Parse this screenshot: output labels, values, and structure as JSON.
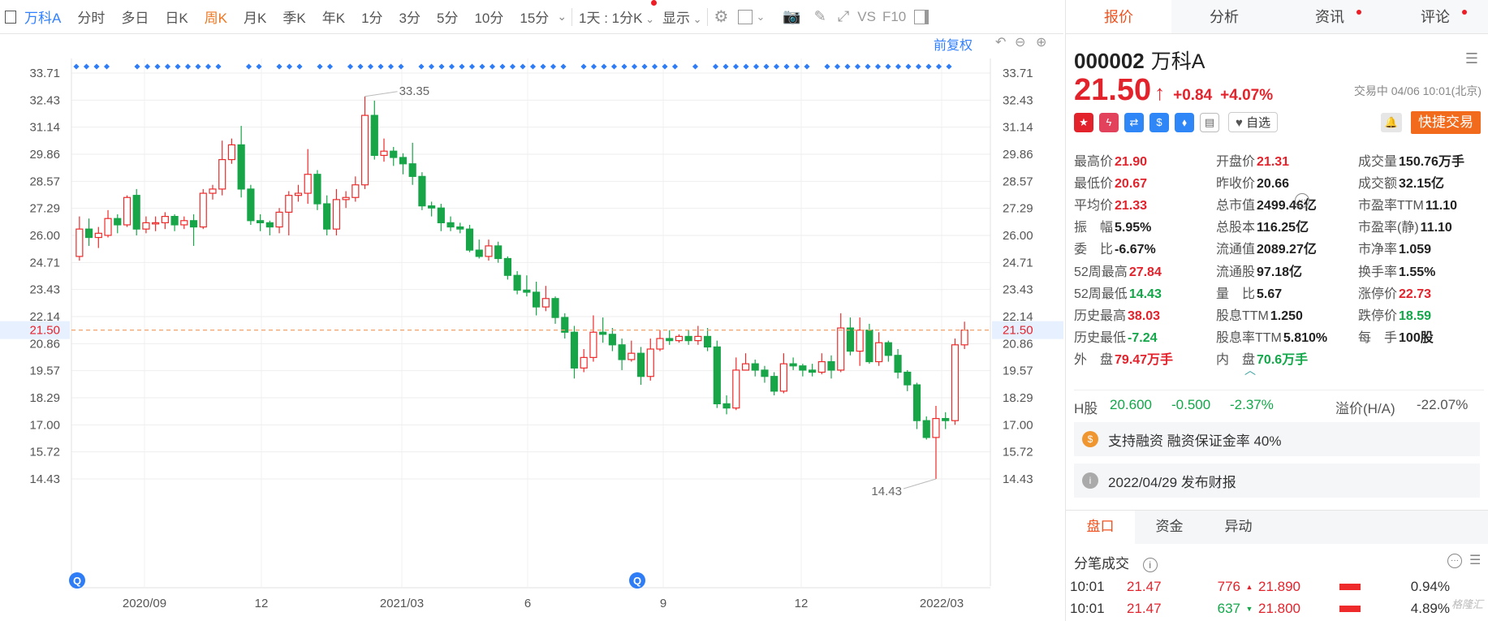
{
  "toolbar": {
    "stock_name": "万科A",
    "periods": [
      "分时",
      "多日",
      "日K",
      "周K",
      "月K",
      "季K",
      "年K",
      "1分",
      "3分",
      "5分",
      "10分",
      "15分"
    ],
    "active_period": "周K",
    "combo": "1天 : 1分K",
    "display": "显示",
    "vs": "VS",
    "f10": "F10",
    "restore": "前复权"
  },
  "chart": {
    "y_ticks": [
      "33.71",
      "32.43",
      "31.14",
      "29.86",
      "28.57",
      "27.29",
      "26.00",
      "24.71",
      "23.43",
      "22.14",
      "20.86",
      "19.57",
      "18.29",
      "17.00",
      "15.72",
      "14.43"
    ],
    "x_ticks": [
      "2020/09",
      "12",
      "2021/03",
      "6",
      "9",
      "12",
      "2022/03"
    ],
    "current_price_label": "21.50",
    "high_label": "33.35",
    "low_label": "14.43"
  },
  "chart_data": {
    "type": "candlestick",
    "ylim": [
      14.43,
      33.71
    ],
    "last": 21.5,
    "candles": [
      [
        25.0,
        26.3,
        24.8,
        26.9
      ],
      [
        26.3,
        25.9,
        25.5,
        26.8
      ],
      [
        25.9,
        26.1,
        25.4,
        26.4
      ],
      [
        26.0,
        26.8,
        25.9,
        27.2
      ],
      [
        26.8,
        26.5,
        26.1,
        27.0
      ],
      [
        26.5,
        27.8,
        26.4,
        27.9
      ],
      [
        27.9,
        26.3,
        26.0,
        28.2
      ],
      [
        26.3,
        26.6,
        26.1,
        26.9
      ],
      [
        26.6,
        26.6,
        26.2,
        26.9
      ],
      [
        26.6,
        26.9,
        26.3,
        27.1
      ],
      [
        26.9,
        26.5,
        26.2,
        27.0
      ],
      [
        26.5,
        26.7,
        26.3,
        26.9
      ],
      [
        26.7,
        26.4,
        25.5,
        27.0
      ],
      [
        26.4,
        28.0,
        26.3,
        28.2
      ],
      [
        28.0,
        28.2,
        27.7,
        28.4
      ],
      [
        28.2,
        29.6,
        27.9,
        30.5
      ],
      [
        29.6,
        30.3,
        29.4,
        30.6
      ],
      [
        30.3,
        28.2,
        27.8,
        31.2
      ],
      [
        28.2,
        26.7,
        26.5,
        28.4
      ],
      [
        26.7,
        26.6,
        26.2,
        27.0
      ],
      [
        26.6,
        26.4,
        26.0,
        26.7
      ],
      [
        26.4,
        27.1,
        26.1,
        27.3
      ],
      [
        27.1,
        27.9,
        26.0,
        28.1
      ],
      [
        27.9,
        28.0,
        27.6,
        28.4
      ],
      [
        28.0,
        28.9,
        27.5,
        30.1
      ],
      [
        28.9,
        27.5,
        27.2,
        29.1
      ],
      [
        27.5,
        26.3,
        26.0,
        27.9
      ],
      [
        26.3,
        27.7,
        26.0,
        28.2
      ],
      [
        27.7,
        27.8,
        27.3,
        28.1
      ],
      [
        27.8,
        28.4,
        27.6,
        28.8
      ],
      [
        28.4,
        31.7,
        28.2,
        32.6
      ],
      [
        31.7,
        29.8,
        29.6,
        32.4
      ],
      [
        29.8,
        30.0,
        29.5,
        30.6
      ],
      [
        30.0,
        29.7,
        29.3,
        30.2
      ],
      [
        29.7,
        29.4,
        28.9,
        29.9
      ],
      [
        29.4,
        28.8,
        28.4,
        30.4
      ],
      [
        28.8,
        27.4,
        27.2,
        29.0
      ],
      [
        27.4,
        27.3,
        26.9,
        27.6
      ],
      [
        27.3,
        26.6,
        26.2,
        27.5
      ],
      [
        26.6,
        26.4,
        26.2,
        26.9
      ],
      [
        26.4,
        26.3,
        26.1,
        26.6
      ],
      [
        26.3,
        25.3,
        25.2,
        26.5
      ],
      [
        25.3,
        25.0,
        24.9,
        25.8
      ],
      [
        25.0,
        25.5,
        24.8,
        25.8
      ],
      [
        25.5,
        24.9,
        24.7,
        25.7
      ],
      [
        24.9,
        24.1,
        23.9,
        25.0
      ],
      [
        24.1,
        23.4,
        23.2,
        24.3
      ],
      [
        23.4,
        23.3,
        23.1,
        24.1
      ],
      [
        23.3,
        22.6,
        22.2,
        23.8
      ],
      [
        22.6,
        23.0,
        22.4,
        23.6
      ],
      [
        23.0,
        22.1,
        21.8,
        23.1
      ],
      [
        22.1,
        21.4,
        21.1,
        22.3
      ],
      [
        21.4,
        19.7,
        19.2,
        21.7
      ],
      [
        19.7,
        20.2,
        19.5,
        20.6
      ],
      [
        20.2,
        21.4,
        20.0,
        22.2
      ],
      [
        21.4,
        21.3,
        20.9,
        22.1
      ],
      [
        21.3,
        20.8,
        20.5,
        21.6
      ],
      [
        20.8,
        20.1,
        19.6,
        21.1
      ],
      [
        20.1,
        20.4,
        20.0,
        21.0
      ],
      [
        20.4,
        19.3,
        18.9,
        20.7
      ],
      [
        19.3,
        20.6,
        19.1,
        21.1
      ],
      [
        20.6,
        21.1,
        20.5,
        21.5
      ],
      [
        21.1,
        21.0,
        20.8,
        21.5
      ],
      [
        21.0,
        21.2,
        20.9,
        21.3
      ],
      [
        21.2,
        21.0,
        20.8,
        21.5
      ],
      [
        21.0,
        21.2,
        20.8,
        21.7
      ],
      [
        21.2,
        20.7,
        20.5,
        21.6
      ],
      [
        20.7,
        18.0,
        17.8,
        21.0
      ],
      [
        18.0,
        17.8,
        17.5,
        18.4
      ],
      [
        17.8,
        19.6,
        17.7,
        20.2
      ],
      [
        19.6,
        19.9,
        19.6,
        20.4
      ],
      [
        19.9,
        19.6,
        19.3,
        20.1
      ],
      [
        19.6,
        19.3,
        19.0,
        19.8
      ],
      [
        19.3,
        18.6,
        18.4,
        19.5
      ],
      [
        18.6,
        19.9,
        18.5,
        20.4
      ],
      [
        19.9,
        19.8,
        19.6,
        20.2
      ],
      [
        19.8,
        19.6,
        19.3,
        19.9
      ],
      [
        19.6,
        19.5,
        19.3,
        19.9
      ],
      [
        19.5,
        20.0,
        19.4,
        20.4
      ],
      [
        20.0,
        19.6,
        19.2,
        20.3
      ],
      [
        19.6,
        21.6,
        19.5,
        22.3
      ],
      [
        21.6,
        20.5,
        20.3,
        22.1
      ],
      [
        20.5,
        21.5,
        19.8,
        22.1
      ],
      [
        21.5,
        20.0,
        19.9,
        21.8
      ],
      [
        20.0,
        20.9,
        19.8,
        21.4
      ],
      [
        20.9,
        20.3,
        20.0,
        21.0
      ],
      [
        20.3,
        19.5,
        19.2,
        20.6
      ],
      [
        19.5,
        18.9,
        18.6,
        19.6
      ],
      [
        18.9,
        17.2,
        16.8,
        19.0
      ],
      [
        17.2,
        16.4,
        16.3,
        17.4
      ],
      [
        16.4,
        17.3,
        14.43,
        17.9
      ],
      [
        17.3,
        17.2,
        16.8,
        17.6
      ],
      [
        17.2,
        20.8,
        17.0,
        21.1
      ],
      [
        20.8,
        21.5,
        20.6,
        21.9
      ]
    ]
  },
  "quote": {
    "code": "000002",
    "name": "万科A",
    "price": "21.50",
    "arrow": "↑",
    "change": "+0.84",
    "change_pct": "+4.07%",
    "status": "交易中 04/06 10:01(北京)",
    "watch": "自选",
    "quick_trade": "快捷交易"
  },
  "tabs": [
    "报价",
    "分析",
    "资讯",
    "评论"
  ],
  "stats": [
    [
      {
        "l": "最高价",
        "v": "21.90",
        "c": "red"
      },
      {
        "l": "开盘价",
        "v": "21.31",
        "c": "red"
      },
      {
        "l": "成交量",
        "v": "150.76万手",
        "c": ""
      }
    ],
    [
      {
        "l": "最低价",
        "v": "20.67",
        "c": "red"
      },
      {
        "l": "昨收价",
        "v": "20.66",
        "c": ""
      },
      {
        "l": "成交额",
        "v": "32.15亿",
        "c": ""
      }
    ],
    [
      {
        "l": "平均价",
        "v": "21.33",
        "c": "red"
      },
      {
        "l": "总市值",
        "v": "2499.46亿",
        "c": ""
      },
      {
        "l": "市盈率TTM",
        "v": "11.10",
        "c": ""
      }
    ],
    [
      {
        "l": "振　幅",
        "v": "5.95%",
        "c": ""
      },
      {
        "l": "总股本",
        "v": "116.25亿",
        "c": ""
      },
      {
        "l": "市盈率(静)",
        "v": "11.10",
        "c": ""
      }
    ],
    [
      {
        "l": "委　比",
        "v": "-6.67%",
        "c": ""
      },
      {
        "l": "流通值",
        "v": "2089.27亿",
        "c": ""
      },
      {
        "l": "市净率",
        "v": "1.059",
        "c": ""
      }
    ],
    [
      {
        "l": "52周最高",
        "v": "27.84",
        "c": "red"
      },
      {
        "l": "流通股",
        "v": "97.18亿",
        "c": ""
      },
      {
        "l": "换手率",
        "v": "1.55%",
        "c": ""
      }
    ],
    [
      {
        "l": "52周最低",
        "v": "14.43",
        "c": "green"
      },
      {
        "l": "量　比",
        "v": "5.67",
        "c": ""
      },
      {
        "l": "涨停价",
        "v": "22.73",
        "c": "red"
      }
    ],
    [
      {
        "l": "历史最高",
        "v": "38.03",
        "c": "red"
      },
      {
        "l": "股息TTM",
        "v": "1.250",
        "c": ""
      },
      {
        "l": "跌停价",
        "v": "18.59",
        "c": "green"
      }
    ],
    [
      {
        "l": "历史最低",
        "v": "-7.24",
        "c": "green"
      },
      {
        "l": "股息率TTM",
        "v": "5.810%",
        "c": ""
      },
      {
        "l": "每　手",
        "v": "100股",
        "c": ""
      }
    ],
    [
      {
        "l": "外　盘",
        "v": "79.47万手",
        "c": "red"
      },
      {
        "l": "内　盘",
        "v": "70.6万手",
        "c": "green"
      },
      {
        "l": "",
        "v": "",
        "c": ""
      }
    ]
  ],
  "hshare": {
    "label": "H股",
    "price": "20.600",
    "change": "-0.500",
    "pct": "-2.37%",
    "premium_label": "溢价(H/A)",
    "premium": "-22.07%"
  },
  "margin_text": "支持融资 融资保证金率 40%",
  "report_text": "2022/04/29  发布财报",
  "bottom_tabs": [
    "盘口",
    "资金",
    "异动"
  ],
  "fenbi_title": "分笔成交",
  "trades": [
    {
      "time": "10:01",
      "price": "21.47",
      "vol": "776",
      "dir": "up",
      "price2": "21.890",
      "pct": "0.94%"
    },
    {
      "time": "10:01",
      "price": "21.47",
      "vol": "637",
      "dir": "down",
      "price2": "21.800",
      "pct": "4.89%"
    }
  ],
  "watermark": "格隆汇"
}
